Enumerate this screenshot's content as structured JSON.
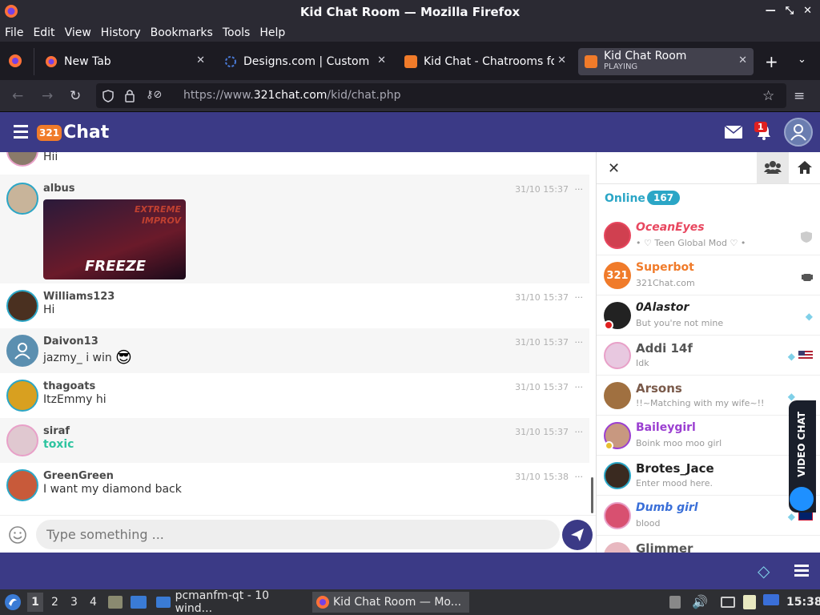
{
  "window": {
    "title": "Kid Chat Room — Mozilla Firefox"
  },
  "menu": [
    "File",
    "Edit",
    "View",
    "History",
    "Bookmarks",
    "Tools",
    "Help"
  ],
  "tabs": [
    {
      "label": "New Tab"
    },
    {
      "label": "Designs.com | Custom De"
    },
    {
      "label": "Kid Chat - Chatrooms for"
    },
    {
      "label": "Kid Chat Room",
      "sub": "PLAYING"
    }
  ],
  "url": {
    "prefix": "https://www.",
    "domain": "321chat.com",
    "path": "/kid/chat.php"
  },
  "app": {
    "logo_badge": "321",
    "logo_text": "Chat",
    "notif_count": "1",
    "accent": "#3b3a86"
  },
  "messages": [
    {
      "user": "",
      "text": "Hii",
      "time": ""
    },
    {
      "user": "albus",
      "text": "",
      "time": "31/10 15:37",
      "image_text_top": "EXTREME IMPROV",
      "image_text_main": "FREEZE"
    },
    {
      "user": "Williams123",
      "text": "Hi",
      "time": "31/10 15:37"
    },
    {
      "user": "Daivon13",
      "text": "jazmy_ i win",
      "time": "31/10 15:37"
    },
    {
      "user": "thagoats",
      "text": "ItzEmmy hi",
      "time": "31/10 15:37"
    },
    {
      "user": "siraf",
      "text": "toxic",
      "time": "31/10 15:37"
    },
    {
      "user": "GreenGreen",
      "text": "I want my diamond back",
      "time": "31/10 15:38"
    }
  ],
  "composer": {
    "placeholder": "Type something ..."
  },
  "sidebar": {
    "online_label": "Online",
    "online_count": "167",
    "users": [
      {
        "name": "OceanEyes",
        "status": "• ♡ Teen Global Mod ♡ •",
        "color": "#e8475f"
      },
      {
        "name": "Superbot",
        "status": "321Chat.com",
        "color": "#f07b2a"
      },
      {
        "name": "0Alastor",
        "status": "But you're not mine",
        "color": "#222222"
      },
      {
        "name": "Addi 14f",
        "status": "Idk",
        "color": "#555555"
      },
      {
        "name": "Arsons",
        "status": "!!~Matching with my wife~!!",
        "color": "#7a5a4a"
      },
      {
        "name": "Baileygirl",
        "status": "Boink moo moo girl",
        "color": "#9b3fd1"
      },
      {
        "name": "Brotes_Jace",
        "status": "Enter mood here.",
        "color": "#222222"
      },
      {
        "name": "Dumb girl",
        "status": "blood",
        "color": "#3a6fd8"
      },
      {
        "name": "Glimmer",
        "status": "",
        "color": "#555555"
      }
    ]
  },
  "video_chat": {
    "label": "VIDEO CHAT"
  },
  "taskbar": {
    "workspaces": [
      "1",
      "2",
      "3",
      "4"
    ],
    "apps": [
      {
        "label": "pcmanfm-qt - 10 wind..."
      },
      {
        "label": "Kid Chat Room — Mo..."
      }
    ],
    "clock": "15:38"
  }
}
